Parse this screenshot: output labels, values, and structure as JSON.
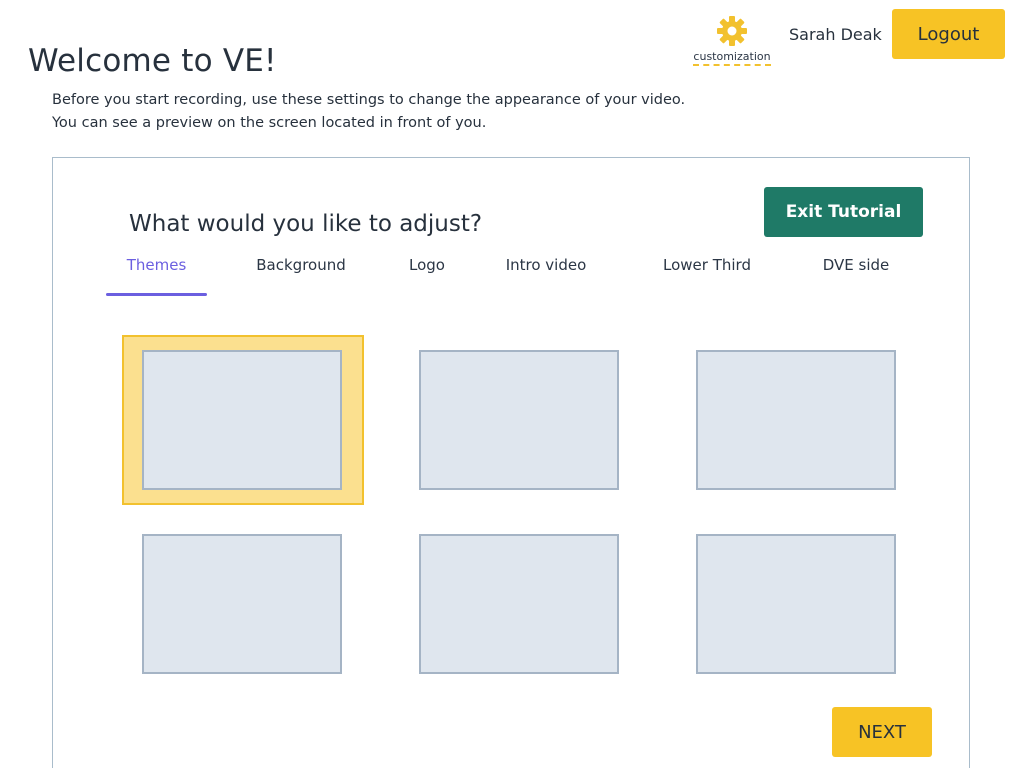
{
  "header": {
    "title": "Welcome to VE!",
    "customization_label": "customization",
    "customization_icon": "gear-icon",
    "user_name": "Sarah Deak",
    "logout_label": "Logout"
  },
  "intro": {
    "line1": "Before you start recording, use these settings to change the appearance of your video.",
    "line2": "You can see a preview on the screen located in front of you."
  },
  "panel": {
    "heading": "What would you like to adjust?",
    "exit_label": "Exit Tutorial",
    "tabs": [
      {
        "label": "Themes",
        "active": true
      },
      {
        "label": "Background",
        "active": false
      },
      {
        "label": "Logo",
        "active": false
      },
      {
        "label": "Intro video",
        "active": false
      },
      {
        "label": "Lower Third",
        "active": false
      },
      {
        "label": "DVE side",
        "active": false
      }
    ],
    "themes_count": 6,
    "selected_theme_index": 0,
    "next_label": "NEXT"
  },
  "colors": {
    "accent_yellow": "#f7c325",
    "exit_green": "#1f7a67",
    "active_tab": "#6b5fe0",
    "tile_fill": "#dfe6ee",
    "tile_border": "#a5b4c5",
    "selection_fill": "#fbe08f"
  }
}
